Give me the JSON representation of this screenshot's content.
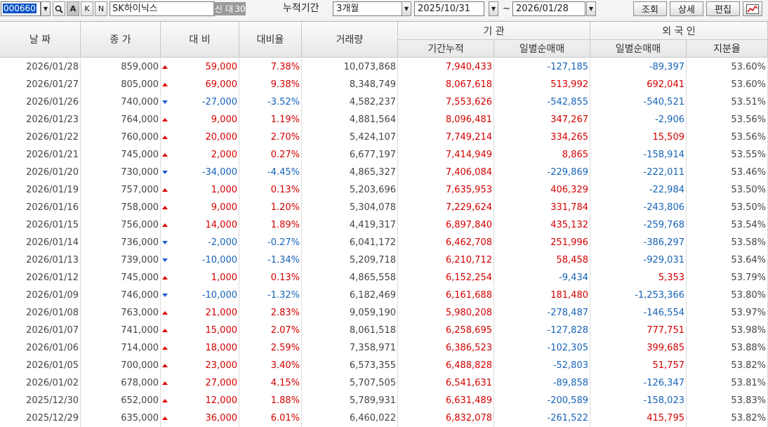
{
  "toolbar": {
    "stock_code": "000660",
    "search_icon": "magnifier-icon",
    "btn_a": "A",
    "btn_k": "K",
    "btn_n": "N",
    "stock_name": "SK하이닉스",
    "badge_new": "신",
    "badge_loan": "대",
    "badge_30": "30",
    "period_label": "누적기간",
    "period_value": "3개월",
    "start_date": "2025/10/31",
    "tilde": "~",
    "end_date": "2026/01/28",
    "query_btn": "조회",
    "detail_btn": "상세",
    "edit_btn": "편집",
    "chart_icon": "chart-icon"
  },
  "header": {
    "date": "날 짜",
    "close": "종 가",
    "change": "대 비",
    "change_rate": "대비율",
    "volume": "거래량",
    "inst_group": "기 관",
    "inst_cum": "기간누적",
    "inst_daily": "일별순매매",
    "foreign_group": "외 국 인",
    "foreign_daily": "일별순매매",
    "foreign_share": "지분율"
  },
  "colors": {
    "up": "#d40000",
    "down": "#1663b8"
  },
  "rows": [
    {
      "date": "2026/01/28",
      "close": "859,000",
      "dir": "up",
      "change": "59,000",
      "rate": "7.38%",
      "volume": "10,073,868",
      "inst_cum": "7,940,433",
      "inst_daily": "-127,185",
      "foreign_daily": "-89,397",
      "share": "53.60%"
    },
    {
      "date": "2026/01/27",
      "close": "805,000",
      "dir": "up",
      "change": "69,000",
      "rate": "9.38%",
      "volume": "8,348,749",
      "inst_cum": "8,067,618",
      "inst_daily": "513,992",
      "foreign_daily": "692,041",
      "share": "53.60%"
    },
    {
      "date": "2026/01/26",
      "close": "740,000",
      "dir": "down",
      "change": "-27,000",
      "rate": "-3.52%",
      "volume": "4,582,237",
      "inst_cum": "7,553,626",
      "inst_daily": "-542,855",
      "foreign_daily": "-540,521",
      "share": "53.51%"
    },
    {
      "date": "2026/01/23",
      "close": "764,000",
      "dir": "up",
      "change": "9,000",
      "rate": "1.19%",
      "volume": "4,881,564",
      "inst_cum": "8,096,481",
      "inst_daily": "347,267",
      "foreign_daily": "-2,906",
      "share": "53.56%"
    },
    {
      "date": "2026/01/22",
      "close": "760,000",
      "dir": "up",
      "change": "20,000",
      "rate": "2.70%",
      "volume": "5,424,107",
      "inst_cum": "7,749,214",
      "inst_daily": "334,265",
      "foreign_daily": "15,509",
      "share": "53.56%"
    },
    {
      "date": "2026/01/21",
      "close": "745,000",
      "dir": "up",
      "change": "2,000",
      "rate": "0.27%",
      "volume": "6,677,197",
      "inst_cum": "7,414,949",
      "inst_daily": "8,865",
      "foreign_daily": "-158,914",
      "share": "53.55%"
    },
    {
      "date": "2026/01/20",
      "close": "730,000",
      "dir": "down",
      "change": "-34,000",
      "rate": "-4.45%",
      "volume": "4,865,327",
      "inst_cum": "7,406,084",
      "inst_daily": "-229,869",
      "foreign_daily": "-222,011",
      "share": "53.46%"
    },
    {
      "date": "2026/01/19",
      "close": "757,000",
      "dir": "up",
      "change": "1,000",
      "rate": "0.13%",
      "volume": "5,203,696",
      "inst_cum": "7,635,953",
      "inst_daily": "406,329",
      "foreign_daily": "-22,984",
      "share": "53.50%"
    },
    {
      "date": "2026/01/16",
      "close": "758,000",
      "dir": "up",
      "change": "9,000",
      "rate": "1.20%",
      "volume": "5,304,078",
      "inst_cum": "7,229,624",
      "inst_daily": "331,784",
      "foreign_daily": "-243,806",
      "share": "53.50%"
    },
    {
      "date": "2026/01/15",
      "close": "756,000",
      "dir": "up",
      "change": "14,000",
      "rate": "1.89%",
      "volume": "4,419,317",
      "inst_cum": "6,897,840",
      "inst_daily": "435,132",
      "foreign_daily": "-259,768",
      "share": "53.54%"
    },
    {
      "date": "2026/01/14",
      "close": "736,000",
      "dir": "down",
      "change": "-2,000",
      "rate": "-0.27%",
      "volume": "6,041,172",
      "inst_cum": "6,462,708",
      "inst_daily": "251,996",
      "foreign_daily": "-386,297",
      "share": "53.58%"
    },
    {
      "date": "2026/01/13",
      "close": "739,000",
      "dir": "down",
      "change": "-10,000",
      "rate": "-1.34%",
      "volume": "5,209,718",
      "inst_cum": "6,210,712",
      "inst_daily": "58,458",
      "foreign_daily": "-929,031",
      "share": "53.64%"
    },
    {
      "date": "2026/01/12",
      "close": "745,000",
      "dir": "up",
      "change": "1,000",
      "rate": "0.13%",
      "volume": "4,865,558",
      "inst_cum": "6,152,254",
      "inst_daily": "-9,434",
      "foreign_daily": "5,353",
      "share": "53.79%"
    },
    {
      "date": "2026/01/09",
      "close": "746,000",
      "dir": "down",
      "change": "-10,000",
      "rate": "-1.32%",
      "volume": "6,182,469",
      "inst_cum": "6,161,688",
      "inst_daily": "181,480",
      "foreign_daily": "-1,253,366",
      "share": "53.80%"
    },
    {
      "date": "2026/01/08",
      "close": "763,000",
      "dir": "up",
      "change": "21,000",
      "rate": "2.83%",
      "volume": "9,059,190",
      "inst_cum": "5,980,208",
      "inst_daily": "-278,487",
      "foreign_daily": "-146,554",
      "share": "53.97%"
    },
    {
      "date": "2026/01/07",
      "close": "741,000",
      "dir": "up",
      "change": "15,000",
      "rate": "2.07%",
      "volume": "8,061,518",
      "inst_cum": "6,258,695",
      "inst_daily": "-127,828",
      "foreign_daily": "777,751",
      "share": "53.98%"
    },
    {
      "date": "2026/01/06",
      "close": "714,000",
      "dir": "up",
      "change": "18,000",
      "rate": "2.59%",
      "volume": "7,358,971",
      "inst_cum": "6,386,523",
      "inst_daily": "-102,305",
      "foreign_daily": "399,685",
      "share": "53.88%"
    },
    {
      "date": "2026/01/05",
      "close": "700,000",
      "dir": "up",
      "change": "23,000",
      "rate": "3.40%",
      "volume": "6,573,355",
      "inst_cum": "6,488,828",
      "inst_daily": "-52,803",
      "foreign_daily": "51,757",
      "share": "53.82%"
    },
    {
      "date": "2026/01/02",
      "close": "678,000",
      "dir": "up",
      "change": "27,000",
      "rate": "4.15%",
      "volume": "5,707,505",
      "inst_cum": "6,541,631",
      "inst_daily": "-89,858",
      "foreign_daily": "-126,347",
      "share": "53.81%"
    },
    {
      "date": "2025/12/30",
      "close": "652,000",
      "dir": "up",
      "change": "12,000",
      "rate": "1.88%",
      "volume": "5,789,931",
      "inst_cum": "6,631,489",
      "inst_daily": "-200,589",
      "foreign_daily": "-158,023",
      "share": "53.83%"
    },
    {
      "date": "2025/12/29",
      "close": "635,000",
      "dir": "up",
      "change": "36,000",
      "rate": "6.01%",
      "volume": "6,460,022",
      "inst_cum": "6,832,078",
      "inst_daily": "-261,522",
      "foreign_daily": "415,795",
      "share": "53.82%"
    }
  ]
}
